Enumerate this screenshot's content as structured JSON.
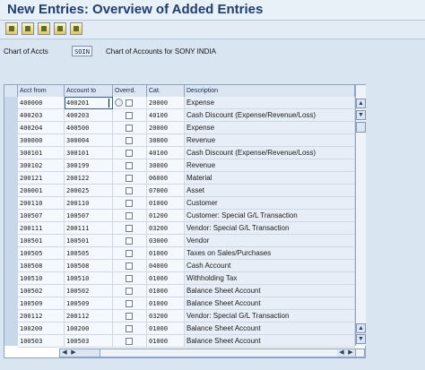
{
  "window": {
    "title": "New Entries: Overview of Added Entries"
  },
  "toolbar": {
    "icons": [
      "edit-icon",
      "save-icon",
      "copy-icon",
      "delete-icon",
      "details-icon"
    ]
  },
  "chart_of_accounts": {
    "label": "Chart of Accts",
    "value": "SOIN",
    "description": "Chart of Accounts for SONY INDIA"
  },
  "table": {
    "columns": [
      "Acct from",
      "Account to",
      "Overrd.",
      "Cat.",
      "Description"
    ],
    "rows": [
      {
        "acct_from": "400000",
        "acct_to": "400201",
        "cat": "20000",
        "desc": "Expense"
      },
      {
        "acct_from": "400203",
        "acct_to": "400203",
        "cat": "40100",
        "desc": "Cash Discount (Expense/Revenue/Loss)"
      },
      {
        "acct_from": "400204",
        "acct_to": "400500",
        "cat": "20000",
        "desc": "Expense"
      },
      {
        "acct_from": "300000",
        "acct_to": "300004",
        "cat": "30000",
        "desc": "Revenue"
      },
      {
        "acct_from": "300101",
        "acct_to": "300101",
        "cat": "40100",
        "desc": "Cash Discount (Expense/Revenue/Loss)"
      },
      {
        "acct_from": "300102",
        "acct_to": "300199",
        "cat": "30000",
        "desc": "Revenue"
      },
      {
        "acct_from": "200121",
        "acct_to": "200122",
        "cat": "06000",
        "desc": "Material"
      },
      {
        "acct_from": "200001",
        "acct_to": "200025",
        "cat": "07000",
        "desc": "Asset"
      },
      {
        "acct_from": "200110",
        "acct_to": "200110",
        "cat": "01000",
        "desc": "Customer"
      },
      {
        "acct_from": "100507",
        "acct_to": "100507",
        "cat": "01200",
        "desc": "Customer: Special G/L Transaction"
      },
      {
        "acct_from": "200111",
        "acct_to": "200111",
        "cat": "03200",
        "desc": "Vendor: Special G/L Transaction"
      },
      {
        "acct_from": "100501",
        "acct_to": "100501",
        "cat": "03000",
        "desc": "Vendor"
      },
      {
        "acct_from": "100505",
        "acct_to": "100505",
        "cat": "01000",
        "desc": "Taxes on Sales/Purchases"
      },
      {
        "acct_from": "100508",
        "acct_to": "100508",
        "cat": "04000",
        "desc": "Cash Account"
      },
      {
        "acct_from": "100510",
        "acct_to": "100510",
        "cat": "01000",
        "desc": "Withholding Tax"
      },
      {
        "acct_from": "100502",
        "acct_to": "100502",
        "cat": "01000",
        "desc": "Balance Sheet Account"
      },
      {
        "acct_from": "100509",
        "acct_to": "100509",
        "cat": "01000",
        "desc": "Balance Sheet Account"
      },
      {
        "acct_from": "200112",
        "acct_to": "200112",
        "cat": "03200",
        "desc": "Vendor: Special G/L Transaction"
      },
      {
        "acct_from": "100200",
        "acct_to": "100200",
        "cat": "01000",
        "desc": "Balance Sheet Account"
      },
      {
        "acct_from": "100503",
        "acct_to": "100503",
        "cat": "01000",
        "desc": "Balance Sheet Account"
      }
    ]
  },
  "scroll": {
    "up_arrow": "▲",
    "down_arrow": "▼",
    "left_arrow": "◀",
    "right_arrow": "▶"
  }
}
